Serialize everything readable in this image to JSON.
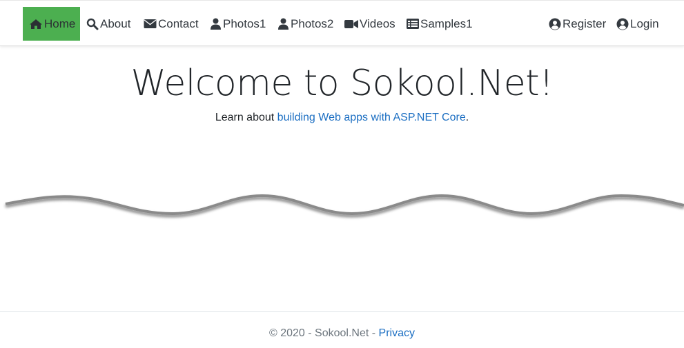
{
  "nav": {
    "items": [
      {
        "label": "Home",
        "icon": "home-icon",
        "active": true
      },
      {
        "label": "About",
        "icon": "search-icon"
      },
      {
        "label": "Contact",
        "icon": "envelope-icon"
      },
      {
        "label": "Photos1",
        "icon": "user-icon"
      },
      {
        "label": "Photos2",
        "icon": "user-icon"
      },
      {
        "label": "Videos",
        "icon": "video-camera-icon"
      },
      {
        "label": "Samples1",
        "icon": "list-table-icon"
      }
    ],
    "right": [
      {
        "label": "Register",
        "icon": "user-circle-icon"
      },
      {
        "label": "Login",
        "icon": "user-circle-icon"
      }
    ],
    "active_color": "#4caf50"
  },
  "main": {
    "title": "Welcome to Sokool.Net!",
    "lead_prefix": "Learn about ",
    "lead_link": "building Web apps with ASP.NET Core",
    "lead_suffix": "."
  },
  "footer": {
    "copyright": "© 2020 - Sokool.Net - ",
    "privacy": "Privacy"
  },
  "colors": {
    "link": "#1b6ec2",
    "text": "#212529",
    "muted": "#6c757d"
  }
}
